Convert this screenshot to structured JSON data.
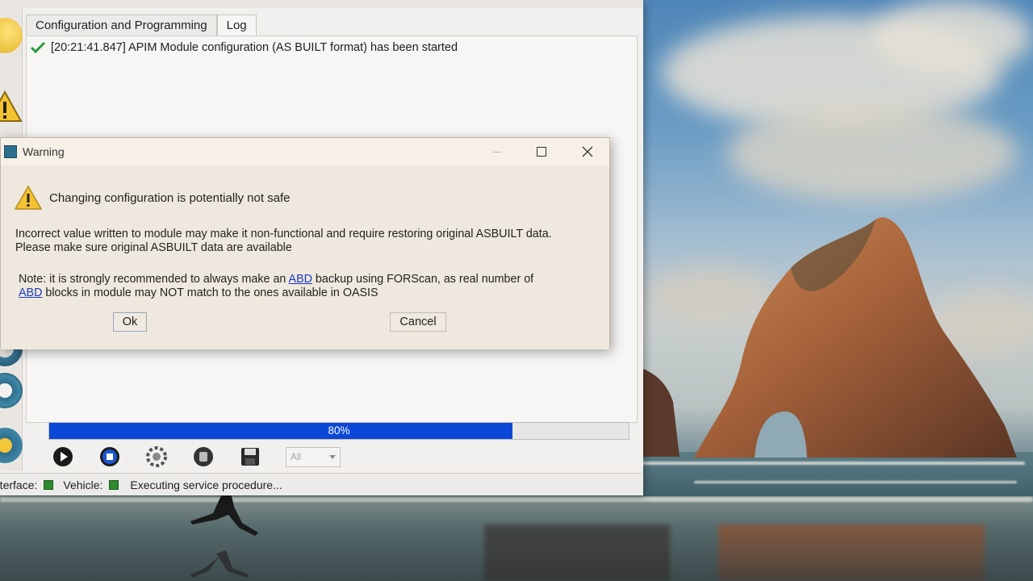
{
  "app": {
    "tabs": [
      {
        "label": "Configuration and Programming",
        "active": false
      },
      {
        "label": "Log",
        "active": true
      }
    ],
    "log": [
      {
        "icon": "checkmark-icon",
        "text": "[20:21:41.847] APIM Module configuration (AS BUILT format) has been started"
      }
    ],
    "progress": {
      "value": 0.8,
      "label": "80%",
      "color": "#0a47d6"
    },
    "controls": {
      "buttons": [
        "play-icon",
        "stop-icon",
        "settings-icon",
        "record-icon",
        "save-icon"
      ],
      "module_select_value": "All"
    },
    "statusbar": {
      "interface_label": "Interface:",
      "vehicle_label": "Vehicle:",
      "status_text": "Executing service procedure..."
    }
  },
  "dialog": {
    "title": "Warning",
    "heading": "Changing configuration is potentially not safe",
    "message": "Incorrect value written to module may make it non-functional and require restoring original ASBUILT data. Please make sure original ASBUILT data are available",
    "note": {
      "part1": "Note: it is strongly recommended to always make an ",
      "link1": "ABD",
      "part2": " backup using FORScan, as real number of ",
      "link2": "ABD",
      "part3": " blocks in module may NOT match to the ones available in OASIS"
    },
    "ok_label": "Ok",
    "cancel_label": "Cancel"
  }
}
